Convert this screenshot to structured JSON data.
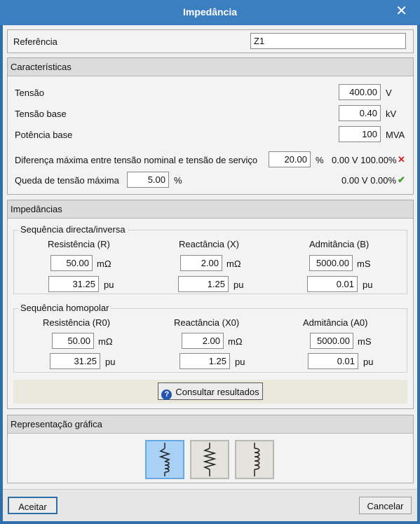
{
  "window": {
    "title": "Impedância",
    "close_glyph": "✕"
  },
  "referencia": {
    "label": "Referência",
    "value": "Z1"
  },
  "caracteristicas": {
    "title": "Características",
    "tensao": {
      "label": "Tensão",
      "value": "400.00",
      "unit": "V"
    },
    "tensao_base": {
      "label": "Tensão base",
      "value": "0.40",
      "unit": "kV"
    },
    "potencia_base": {
      "label": "Potência base",
      "value": "100",
      "unit": "MVA"
    },
    "diferenca": {
      "label": "Diferença máxima entre tensão nominal e tensão de serviço",
      "value": "20.00",
      "unit": "%",
      "result": "0.00 V 100.00%",
      "status_glyph": "✕"
    },
    "queda": {
      "label": "Queda de tensão máxima",
      "value": "5.00",
      "unit": "%",
      "result": "0.00 V 0.00%",
      "status_glyph": "✔"
    }
  },
  "impedancias": {
    "title": "Impedâncias",
    "directa": {
      "title": "Sequência directa/inversa",
      "resistencia": {
        "label": "Resistência (R)",
        "value": "50.00",
        "unit": "mΩ",
        "pu": "31.25",
        "pu_unit": "pu"
      },
      "reactancia": {
        "label": "Reactância (X)",
        "value": "2.00",
        "unit": "mΩ",
        "pu": "1.25",
        "pu_unit": "pu"
      },
      "admitancia": {
        "label": "Admitância (B)",
        "value": "5000.00",
        "unit": "mS",
        "pu": "0.01",
        "pu_unit": "pu"
      }
    },
    "homopolar": {
      "title": "Sequência homopolar",
      "resistencia": {
        "label": "Resistência (R0)",
        "value": "50.00",
        "unit": "mΩ",
        "pu": "31.25",
        "pu_unit": "pu"
      },
      "reactancia": {
        "label": "Reactância (X0)",
        "value": "2.00",
        "unit": "mΩ",
        "pu": "1.25",
        "pu_unit": "pu"
      },
      "admitancia": {
        "label": "Admitância (A0)",
        "value": "5000.00",
        "unit": "mS",
        "pu": "0.01",
        "pu_unit": "pu"
      }
    },
    "consultar": {
      "label": "Consultar resultados",
      "icon": "info-icon"
    }
  },
  "representacao": {
    "title": "Representação gráfica",
    "options": [
      {
        "icon": "resistor-inductor-icon",
        "active": true
      },
      {
        "icon": "resistor-icon",
        "active": false
      },
      {
        "icon": "inductor-icon",
        "active": false
      }
    ]
  },
  "footer": {
    "accept_label": "Aceitar",
    "cancel_label": "Cancelar"
  },
  "colors": {
    "titlebar": "#3c7fc0",
    "accent_ok": "#3aa02a",
    "accent_error": "#d42020",
    "active_option": "#a9d0f5"
  }
}
